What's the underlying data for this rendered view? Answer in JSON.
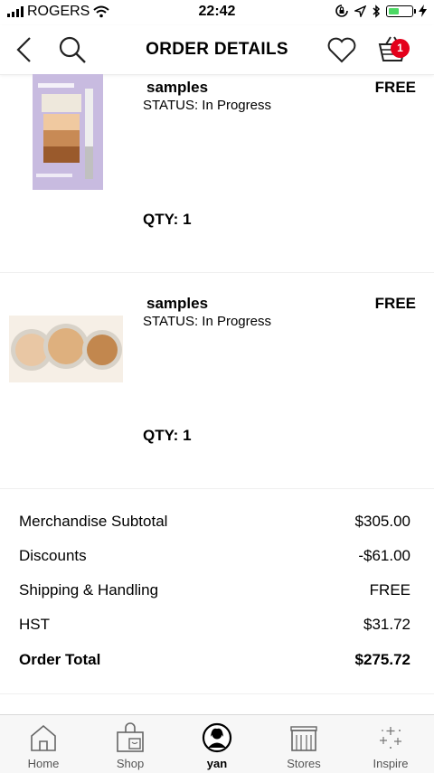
{
  "status_bar": {
    "carrier": "ROGERS",
    "time": "22:42"
  },
  "header": {
    "title": "ORDER DETAILS",
    "cart_count": "1"
  },
  "items": [
    {
      "name": "samples",
      "status": "STATUS: In Progress",
      "price": "FREE",
      "qty": "QTY: 1"
    },
    {
      "name": "samples",
      "status": "STATUS: In Progress",
      "price": "FREE",
      "qty": "QTY: 1"
    }
  ],
  "summary": [
    {
      "label": "Merchandise Subtotal",
      "value": "$305.00"
    },
    {
      "label": "Discounts",
      "value": "-$61.00"
    },
    {
      "label": "Shipping & Handling",
      "value": "FREE"
    },
    {
      "label": "HST",
      "value": "$31.72"
    },
    {
      "label": "Order Total",
      "value": "$275.72"
    }
  ],
  "tabs": [
    {
      "label": "Home",
      "icon": "home-icon"
    },
    {
      "label": "Shop",
      "icon": "shop-bag-icon"
    },
    {
      "label": "yan",
      "icon": "profile-avatar-icon",
      "active": true
    },
    {
      "label": "Stores",
      "icon": "store-icon"
    },
    {
      "label": "Inspire",
      "icon": "sparkle-icon"
    }
  ],
  "colors": {
    "badge": "#e4001b",
    "battery": "#4cd964",
    "tab_bar_bg": "#f7f7f7"
  }
}
